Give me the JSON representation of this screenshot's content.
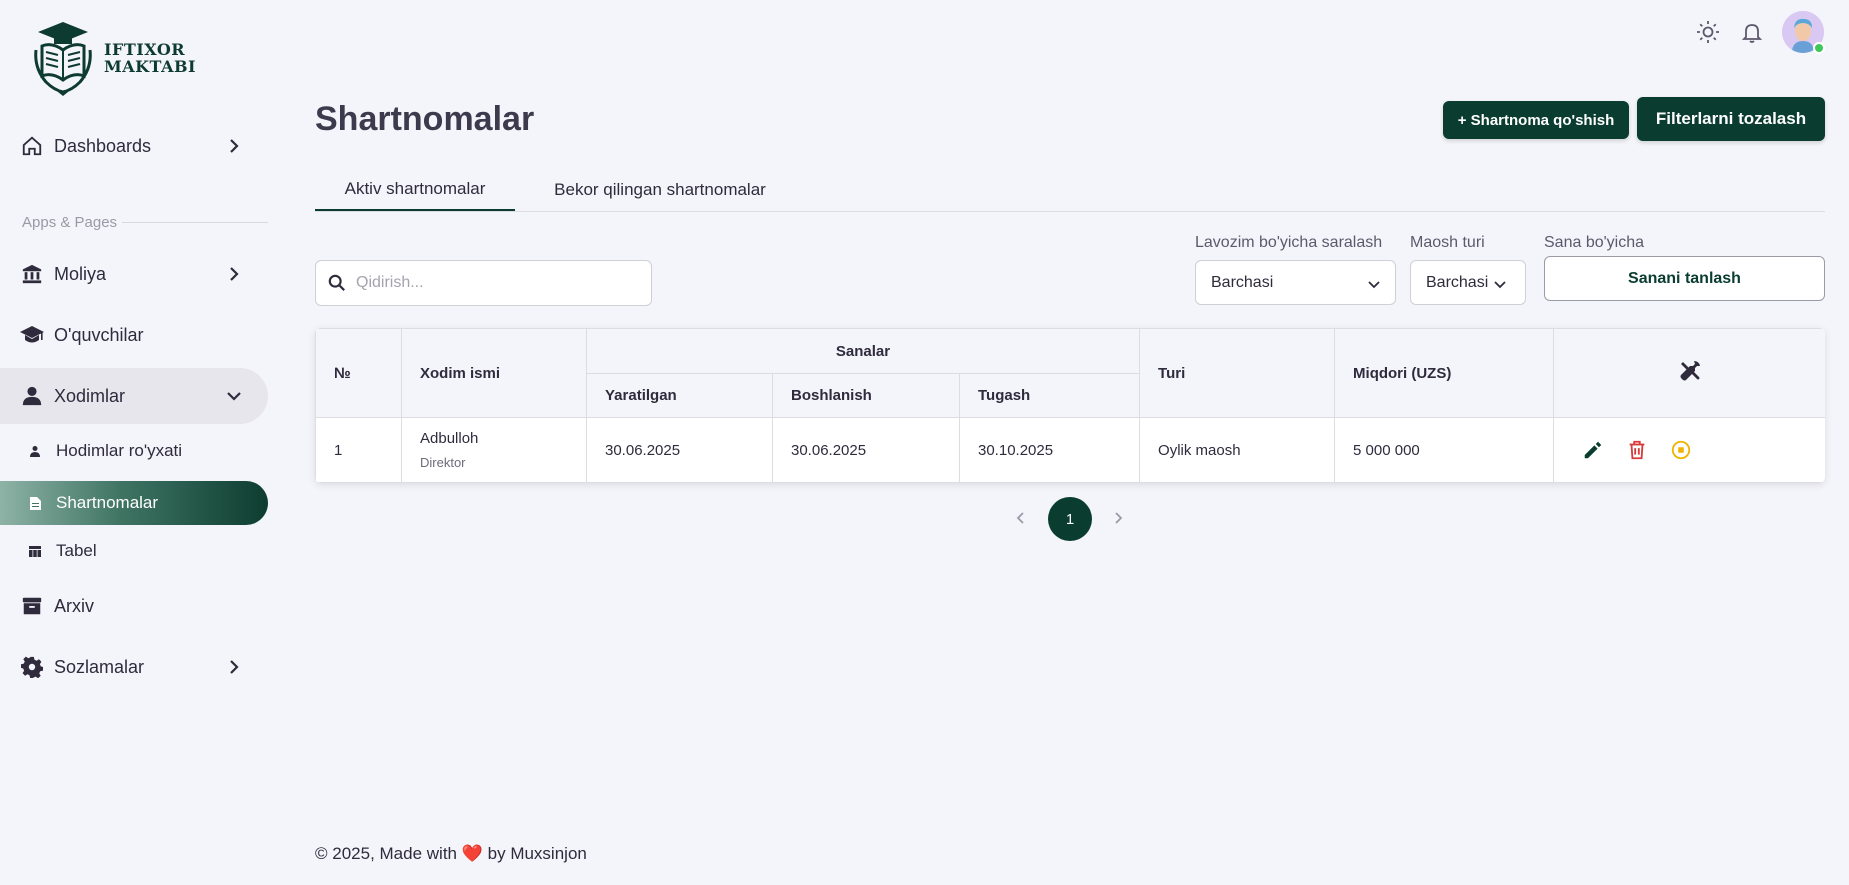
{
  "brand": {
    "line1": "IFTIXOR",
    "line2": "MAKTABI"
  },
  "sidebar": {
    "section_label": "Apps & Pages",
    "items": [
      {
        "label": "Dashboards"
      },
      {
        "label": "Moliya"
      },
      {
        "label": "O'quvchilar"
      },
      {
        "label": "Xodimlar"
      },
      {
        "label": "Arxiv"
      },
      {
        "label": "Sozlamalar"
      }
    ],
    "subitems": [
      {
        "label": "Hodimlar ro'yxati"
      },
      {
        "label": "Shartnomalar"
      },
      {
        "label": "Tabel"
      }
    ]
  },
  "header": {
    "title": "Shartnomalar",
    "add_button": "+ Shartnoma qo'shish",
    "clear_button": "Filterlarni tozalash"
  },
  "tabs": [
    {
      "label": "Aktiv shartnomalar",
      "active": true
    },
    {
      "label": "Bekor qilingan shartnomalar",
      "active": false
    }
  ],
  "filters": {
    "search_placeholder": "Qidirish...",
    "position_label": "Lavozim bo'yicha saralash",
    "position_value": "Barchasi",
    "salary_label": "Maosh turi",
    "salary_value": "Barchasi",
    "date_label": "Sana bo'yicha",
    "date_button": "Sanani tanlash"
  },
  "table": {
    "headers": {
      "number": "№",
      "name": "Xodim ismi",
      "dates_group": "Sanalar",
      "created": "Yaratilgan",
      "start": "Boshlanish",
      "end": "Tugash",
      "type": "Turi",
      "amount": "Miqdori (UZS)"
    },
    "rows": [
      {
        "number": "1",
        "name": "Adbulloh",
        "role": "Direktor",
        "created": "30.06.2025",
        "start": "30.06.2025",
        "end": "30.10.2025",
        "type": "Oylik maosh",
        "amount": "5 000 000"
      }
    ]
  },
  "pagination": {
    "current": "1"
  },
  "footer": {
    "prefix": "© 2025, Made with",
    "heart": "❤️",
    "suffix": "by Muxsinjon"
  },
  "colors": {
    "primary": "#0a3d30",
    "edit": "#0a3d30",
    "delete": "#d63a3a",
    "stop": "#f0b400",
    "online": "#3fc75a"
  }
}
